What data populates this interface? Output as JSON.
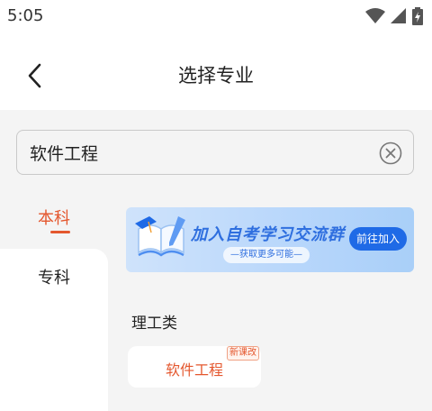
{
  "status_bar": {
    "time": "5:05"
  },
  "header": {
    "title": "选择专业"
  },
  "search": {
    "value": "软件工程"
  },
  "tabs": [
    {
      "label": "本科",
      "active": true
    },
    {
      "label": "专科",
      "active": false
    }
  ],
  "banner": {
    "title": "加入自考学习交流群",
    "subtitle": "—获取更多可能—",
    "button_label": "前往加入"
  },
  "category": {
    "title": "理工类",
    "items": [
      {
        "name": "软件工程",
        "badge": "新课改"
      }
    ]
  },
  "colors": {
    "accent": "#e4572e",
    "banner_blue": "#1f6ae6",
    "background": "#f4f4f4"
  }
}
